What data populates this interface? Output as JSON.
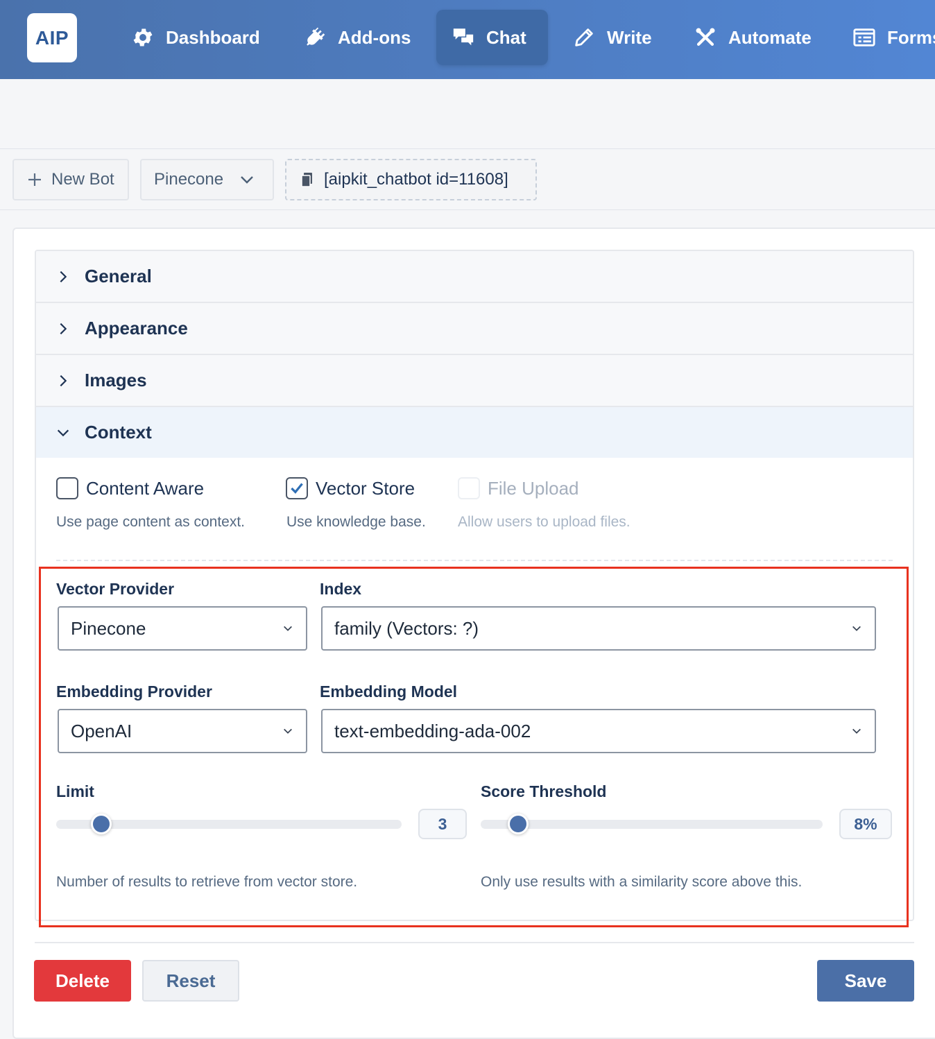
{
  "app": {
    "logo_text": "AIP"
  },
  "nav": {
    "items": [
      {
        "label": "Dashboard",
        "icon": "gear-icon"
      },
      {
        "label": "Add-ons",
        "icon": "plug-icon"
      },
      {
        "label": "Chat",
        "icon": "chat-bubbles-icon",
        "active": true
      },
      {
        "label": "Write",
        "icon": "pencil-icon"
      },
      {
        "label": "Automate",
        "icon": "tools-icon"
      },
      {
        "label": "Forms",
        "icon": "form-icon"
      }
    ]
  },
  "toolbar": {
    "new_bot_label": "New Bot",
    "bot_select_value": "Pinecone",
    "shortcode": "[aipkit_chatbot id=11608]"
  },
  "accordion": {
    "sections": [
      {
        "label": "General",
        "open": false
      },
      {
        "label": "Appearance",
        "open": false
      },
      {
        "label": "Images",
        "open": false
      },
      {
        "label": "Context",
        "open": true
      }
    ]
  },
  "context": {
    "options": [
      {
        "label": "Content Aware",
        "help": "Use page content as context.",
        "checked": false,
        "disabled": false
      },
      {
        "label": "Vector Store",
        "help": "Use knowledge base.",
        "checked": true,
        "disabled": false
      },
      {
        "label": "File Upload",
        "help": "Allow users to upload files.",
        "checked": false,
        "disabled": true
      }
    ],
    "vector_provider": {
      "label": "Vector Provider",
      "value": "Pinecone"
    },
    "index": {
      "label": "Index",
      "value": "family (Vectors: ?)"
    },
    "embedding_provider": {
      "label": "Embedding Provider",
      "value": "OpenAI"
    },
    "embedding_model": {
      "label": "Embedding Model",
      "value": "text-embedding-ada-002"
    },
    "limit": {
      "label": "Limit",
      "value": "3",
      "fraction": 0.13,
      "help": "Number of results to retrieve from vector store."
    },
    "score_threshold": {
      "label": "Score Threshold",
      "value": "8%",
      "fraction": 0.11,
      "help": "Only use results with a similarity score above this."
    }
  },
  "actions": {
    "delete_label": "Delete",
    "reset_label": "Reset",
    "save_label": "Save"
  },
  "colors": {
    "accent": "#4b6fa7",
    "danger": "#e3393c",
    "highlight": "#e8321f",
    "nav_start": "#4a72ac",
    "nav_end": "#5286d4"
  }
}
